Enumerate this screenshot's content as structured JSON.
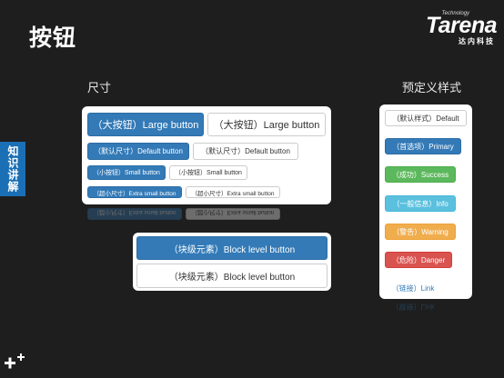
{
  "page": {
    "title": "按钮"
  },
  "logo": {
    "main": "Tarena",
    "tagline": "Technology",
    "sub": "达内科技"
  },
  "side_tab": {
    "label": "知识讲解"
  },
  "sizes": {
    "label": "尺寸",
    "rows": [
      {
        "primary": "（大按钮）Large button",
        "default": "（大按钮）Large button"
      },
      {
        "primary": "（默认尺寸）Default button",
        "default": "（默认尺寸）Default button"
      },
      {
        "primary": "（小按钮）Small button",
        "default": "（小按钮）Small button"
      },
      {
        "primary": "（超小尺寸）Extra small button",
        "default": "（超小尺寸）Extra small button"
      }
    ]
  },
  "block": {
    "primary": "（块级元素）Block level button",
    "default": "（块级元素）Block level button"
  },
  "styles": {
    "label": "预定义样式",
    "buttons": [
      {
        "style": "default",
        "label": "（默认样式）Default"
      },
      {
        "style": "primary",
        "label": "（首选项）Primary"
      },
      {
        "style": "success",
        "label": "（成功）Success"
      },
      {
        "style": "info",
        "label": "（一般信息）Info"
      },
      {
        "style": "warning",
        "label": "（警告）Warning"
      },
      {
        "style": "danger",
        "label": "（危险）Danger"
      },
      {
        "style": "link",
        "label": "（链接）Link"
      }
    ]
  },
  "colors": {
    "background": "#1e1e1e",
    "primary": "#337ab7",
    "success": "#5cb85c",
    "info": "#5bc0de",
    "warning": "#f0ad4e",
    "danger": "#d9534f",
    "side_tab": "#1a6fb5"
  }
}
